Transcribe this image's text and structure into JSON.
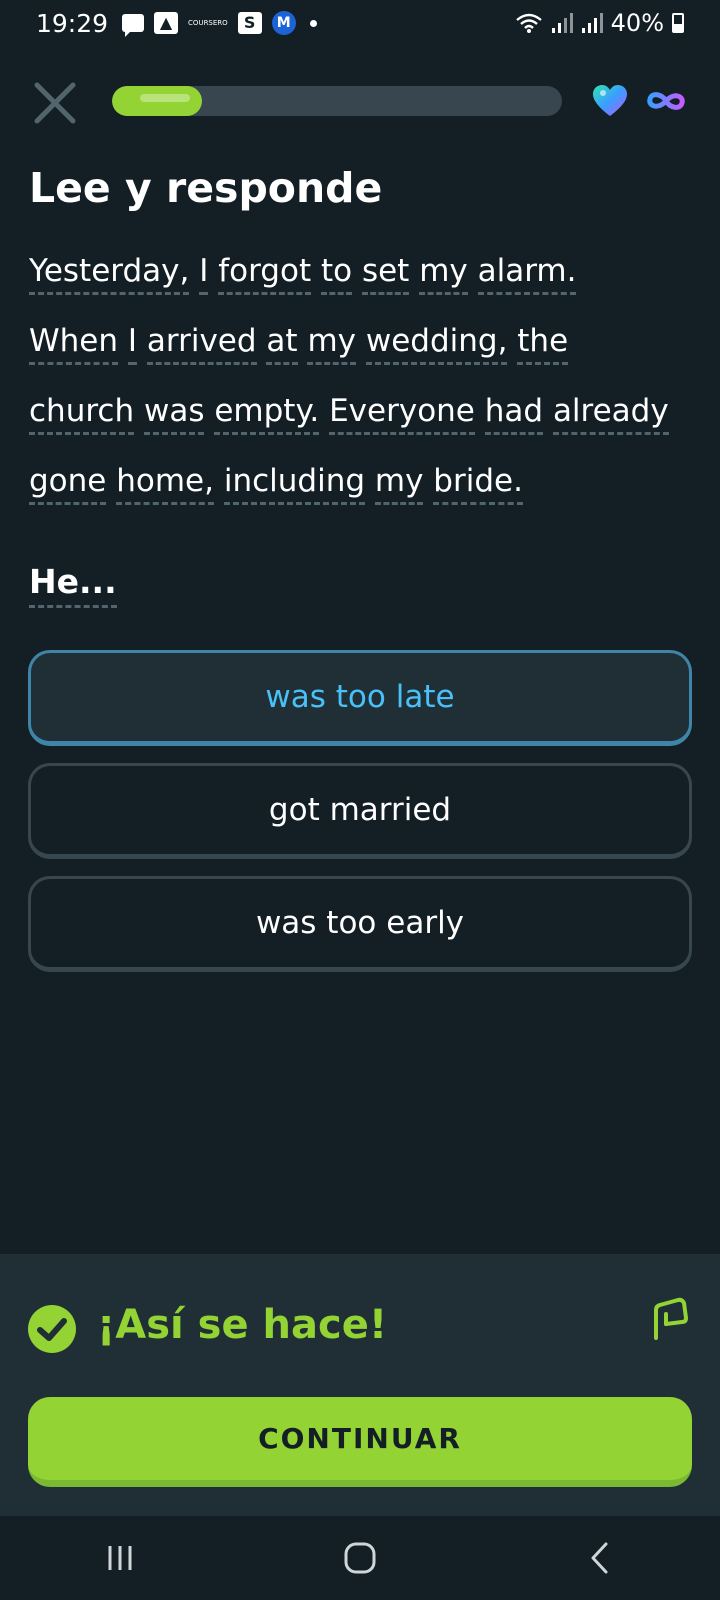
{
  "status_bar": {
    "time": "19:29",
    "tiny_label": "COURSERO",
    "box_s": "S",
    "box_m": "M",
    "battery": "40%"
  },
  "header": {
    "progress_percent": 20
  },
  "exercise": {
    "title": "Lee y responde",
    "passage_words": [
      [
        "Yesterday,",
        "I",
        "forgot",
        "to",
        "set",
        "my",
        "alarm."
      ],
      [
        "When",
        "I",
        "arrived",
        "at",
        "my",
        "wedding,",
        "the"
      ],
      [
        "church",
        "was",
        "empty.",
        "Everyone",
        "had",
        "already"
      ],
      [
        "gone",
        "home,",
        "including",
        "my",
        "bride."
      ]
    ],
    "question": "He...",
    "options": [
      {
        "label": "was too late",
        "selected": true
      },
      {
        "label": "got married",
        "selected": false
      },
      {
        "label": "was too early",
        "selected": false
      }
    ]
  },
  "feedback": {
    "message": "¡Así se hace!",
    "continue_label": "CONTINUAR"
  },
  "colors": {
    "background": "#131f24",
    "accent_green": "#93d333",
    "selected_blue": "#49c0f8",
    "panel": "#202f36"
  },
  "icons": {
    "close": "close-icon",
    "heart": "heart-icon",
    "infinity": "infinity-icon",
    "check": "check-circle-icon",
    "flag": "flag-icon"
  }
}
